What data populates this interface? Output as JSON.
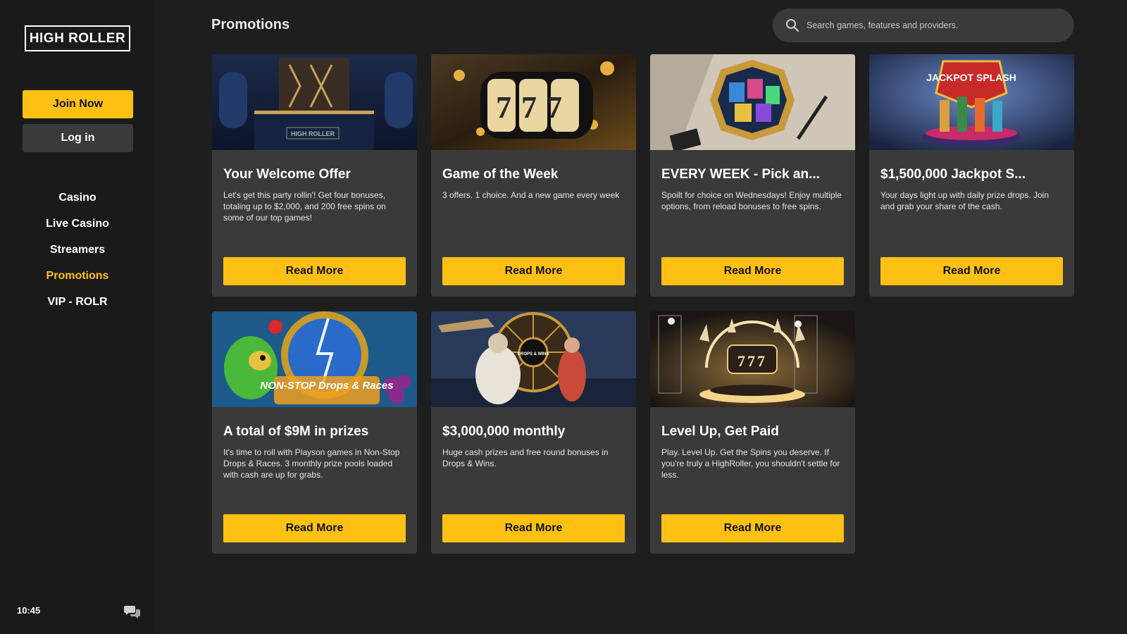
{
  "sidebar": {
    "logo": "HIGH ROLLER",
    "join_label": "Join Now",
    "login_label": "Log in",
    "nav": [
      "Casino",
      "Live Casino",
      "Streamers",
      "Promotions",
      "VIP - ROLR"
    ],
    "active_nav": "Promotions",
    "clock": "10:45"
  },
  "header": {
    "title": "Promotions",
    "search_placeholder": "Search games, features and providers."
  },
  "promotions": [
    {
      "title": "Your Welcome Offer",
      "desc": "Let's get this party rollin'! Get four bonuses, totaling up to $2,000, and 200 free spins on some of our top games!",
      "button": "Read More",
      "image_text": "HIGH ROLLER"
    },
    {
      "title": "Game of the Week",
      "desc": "3 offers. 1 choice. And a new game every week",
      "button": "Read More",
      "image_text": "777"
    },
    {
      "title": "EVERY WEEK - Pick an...",
      "desc": "Spoilt for choice on Wednesdays! Enjoy multiple options, from reload bonuses to free spins.",
      "button": "Read More"
    },
    {
      "title": "$1,500,000 Jackpot S...",
      "desc": "Your days light up with daily prize drops. Join and grab your share of the cash.",
      "button": "Read More",
      "image_text": "JACKPOT SPLASH"
    },
    {
      "title": "A total of $9M in prizes",
      "desc": "It's time to roll with Playson games in Non-Stop Drops & Races. 3 monthly prize pools loaded with cash are up for grabs.",
      "button": "Read More",
      "image_text": "NON-STOP Drops & Races"
    },
    {
      "title": "$3,000,000 monthly",
      "desc": "Huge cash prizes and free round bonuses in Drops & Wins.",
      "button": "Read More",
      "image_text": "DROPS & WINS"
    },
    {
      "title": "Level Up, Get Paid",
      "desc": "Play. Level Up. Get the Spins you deserve. If you're truly a HighRoller, you shouldn't settle for less.",
      "button": "Read More",
      "image_text": "777"
    }
  ],
  "colors": {
    "accent": "#ffc014",
    "background": "#1e1e1e",
    "sidebar": "#1a1a1a",
    "card": "#3a3a3a"
  }
}
